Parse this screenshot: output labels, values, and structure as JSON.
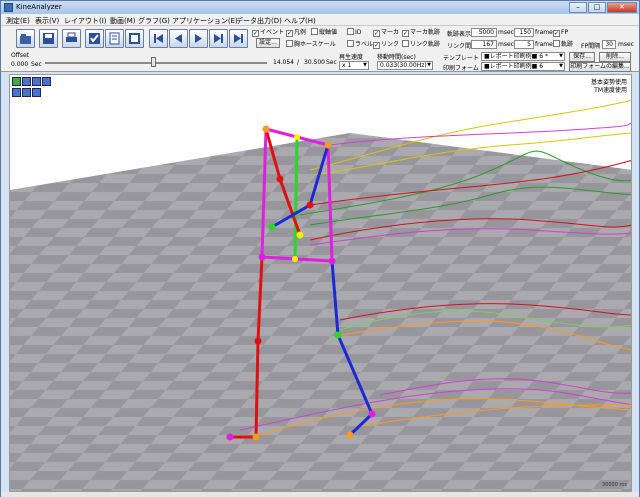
{
  "window": {
    "title": "KineAnalyzer",
    "min": "–",
    "max": "□",
    "close": "✕"
  },
  "menu": [
    "測定(E)",
    "表示(V)",
    "レイアウト(I)",
    "動画(M)",
    "グラフ(G)",
    "アプリケーション(E)",
    "データ出力(D)",
    "ヘルプ(H)"
  ],
  "toolbar": {
    "icons": [
      "open-icon",
      "save-icon",
      "print-icon",
      "check-icon",
      "calculator-icon",
      "grid-icon",
      "skip-start-icon",
      "step-back-icon",
      "play-icon",
      "step-forward-icon",
      "skip-end-icon"
    ],
    "settings_button": "設定...",
    "checkboxes": [
      {
        "label": "イベント",
        "checked": true
      },
      {
        "label": "凡例",
        "checked": true
      },
      {
        "label": "縦軸値",
        "checked": false
      },
      {
        "label": "ID",
        "checked": false
      },
      {
        "label": "マーカ",
        "checked": true
      },
      {
        "label": "マーカ軌跡",
        "checked": true
      },
      {
        "label": "胸ホースケール",
        "checked": false
      },
      {
        "label": "ラベル",
        "checked": false
      },
      {
        "label": "リンク",
        "checked": true
      },
      {
        "label": "リンク軌跡",
        "checked": false
      }
    ],
    "track_display_label": "軌跡表示",
    "track_display_msec": "5000",
    "track_display_msec_unit": "msec",
    "track_display_frames": "150",
    "track_display_frame_unit": "frame",
    "link_interval_label": "リンク間隔",
    "link_interval_msec": "167",
    "link_interval_msec_unit": "msec",
    "link_interval_frames": "5",
    "link_interval_frame_unit": "frame",
    "fp_checkbox": {
      "label": "FP",
      "checked": true
    },
    "track_checkbox": {
      "label": "軌跡",
      "checked": false
    },
    "fp_interval_label": "FP間隔",
    "fp_interval_value": "30",
    "fp_interval_unit": "msec",
    "template_label": "テンプレート",
    "template_value": "■レポート印刷例■ 6 *",
    "print_form_label": "印刷フォーム",
    "print_form_value": "■レポート印刷例■ 6",
    "save_button": "保存...",
    "delete_button": "削除...",
    "edit_form_button": "印刷フォームの編集...",
    "offset_label": "Offset",
    "offset_value": "0.000",
    "offset_unit": "Sec",
    "time_current": "14.054",
    "time_separator": "/",
    "time_total": "30.500",
    "time_unit": "Sec",
    "playback_speed_label": "再生速度",
    "playback_speed_value": "x 1",
    "shift_time_label": "移動時間(sec)",
    "shift_time_value": "0.033(30.00Hz)"
  },
  "view": {
    "legend_line1": "基本姿勢使用",
    "legend_line2": "TM速度使用",
    "frame_label": "30000 ms",
    "floor_color": "#a9a9ae",
    "track_colors": [
      "#d4c400",
      "#2a9c2a",
      "#d0121f",
      "#d040d0",
      "#ff9a1a"
    ]
  }
}
